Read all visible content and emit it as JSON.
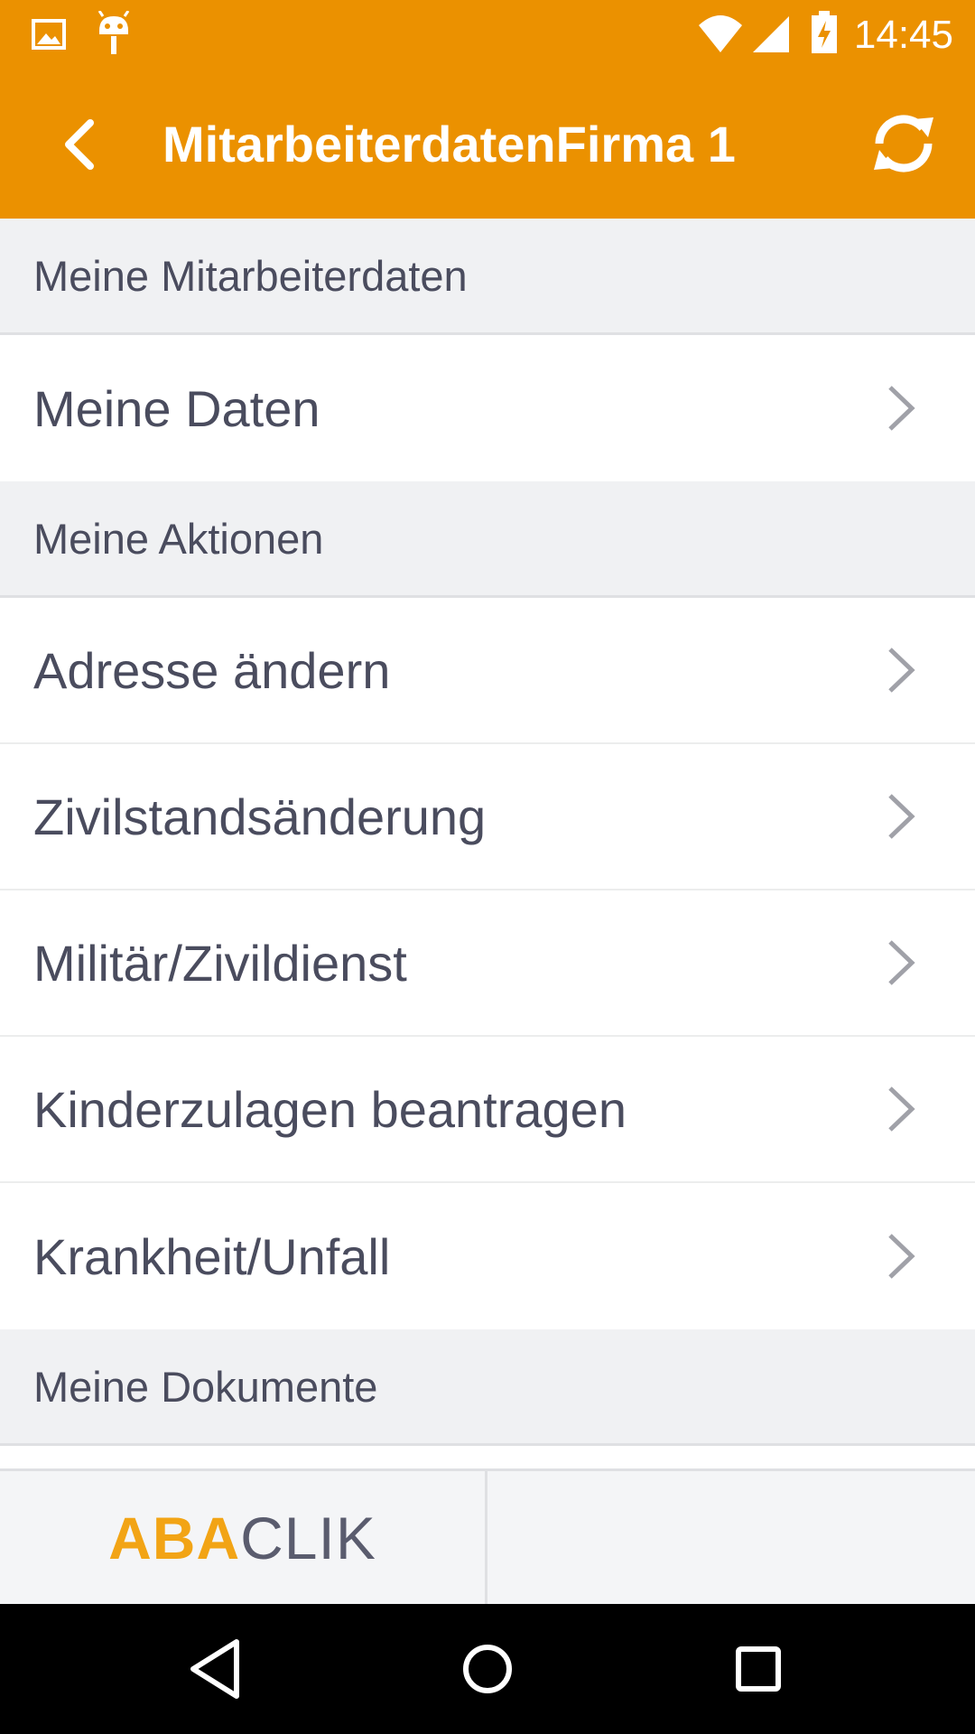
{
  "status_bar": {
    "time": "14:45",
    "icons": [
      "gallery-icon",
      "android-debug-icon",
      "wifi-icon",
      "signal-icon",
      "battery-charging-icon"
    ]
  },
  "app_bar": {
    "title": "MitarbeiterdatenFirma 1",
    "back_icon": "back-arrow-icon",
    "refresh_icon": "refresh-icon"
  },
  "sections": [
    {
      "header": "Meine Mitarbeiterdaten",
      "items": [
        "Meine Daten"
      ]
    },
    {
      "header": "Meine Aktionen",
      "items": [
        "Adresse ändern",
        "Zivilstandsänderung",
        "Militär/Zivildienst",
        "Kinderzulagen beantragen",
        "Krankheit/Unfall"
      ]
    },
    {
      "header": "Meine Dokumente",
      "items": []
    }
  ],
  "bottom_bar": {
    "logo_part1": "ABA",
    "logo_part2": "CLIK"
  },
  "colors": {
    "accent": "#eb9100",
    "logo_accent": "#f2a415",
    "text": "#4a4c5e",
    "section_bg": "#f0f1f3"
  }
}
